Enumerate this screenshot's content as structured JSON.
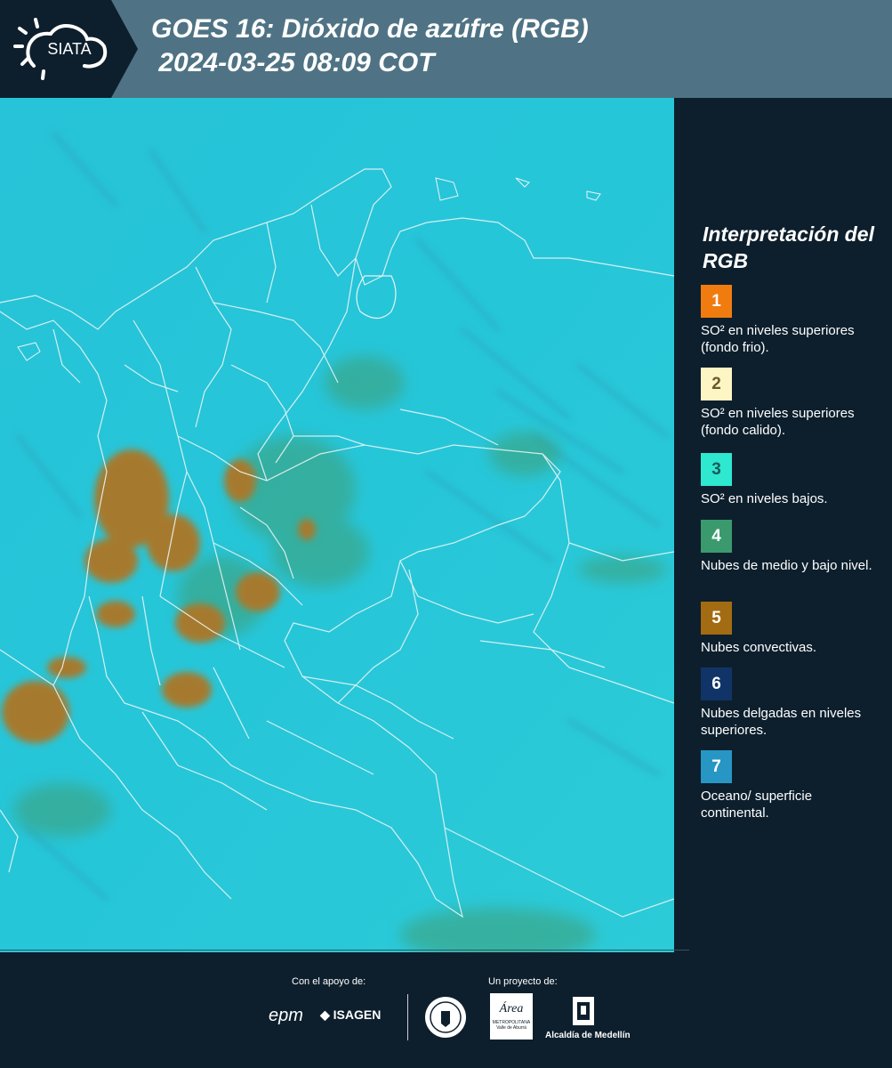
{
  "header": {
    "logo_text": "SIATA",
    "title_line1": "GOES 16: Dióxido de azúfre (RGB)",
    "title_line2": " 2024-03-25 08:09 COT"
  },
  "legend": {
    "title": "Interpretación del RGB",
    "items": [
      {
        "num": "1",
        "color": "#f07c10",
        "text_color": "#ffffff",
        "desc": "SO² en niveles superiores (fondo frio)."
      },
      {
        "num": "2",
        "color": "#fdf6c4",
        "text_color": "#6a5a2a",
        "desc": "SO² en niveles superiores (fondo calido)."
      },
      {
        "num": "3",
        "color": "#2ee8d0",
        "text_color": "#1a5a5a",
        "desc": "SO² en niveles bajos."
      },
      {
        "num": "4",
        "color": "#3a9a6e",
        "text_color": "#ffffff",
        "desc": "Nubes de medio y bajo nivel."
      },
      {
        "num": "5",
        "color": "#a36b12",
        "text_color": "#ffffff",
        "desc": "Nubes convectivas."
      },
      {
        "num": "6",
        "color": "#103468",
        "text_color": "#ffffff",
        "desc": "Nubes delgadas en niveles superiores."
      },
      {
        "num": "7",
        "color": "#2796c4",
        "text_color": "#ffffff",
        "desc": "Oceano/ superficie continental."
      }
    ]
  },
  "footer": {
    "support_label": "Con el apoyo de:",
    "project_label": "Un proyecto de:",
    "sponsors": [
      "epm",
      "ISAGEN"
    ],
    "area_metro_label": "Área",
    "area_metro_sub": "METROPOLITANA",
    "area_metro_sub2": "Valle de Aburrá",
    "alcaldia_label": "Alcaldía de Medellín"
  }
}
